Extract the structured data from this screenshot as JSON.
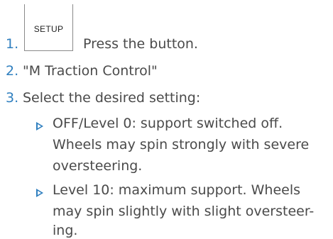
{
  "step1": {
    "number": "1.",
    "button_label": "SETUP",
    "text": "Press the button."
  },
  "step2": {
    "number": "2.",
    "text": "\"M Traction Control\""
  },
  "step3": {
    "number": "3.",
    "text": "Select the desired setting:",
    "options": [
      {
        "lines": [
          "OFF/Level 0: support switched off.",
          "Wheels may spin strongly with severe",
          "oversteering."
        ]
      },
      {
        "lines": [
          "Level 10: maximum support. Wheels",
          "may spin slightly with slight oversteer-",
          "ing."
        ]
      }
    ]
  },
  "colors": {
    "accent": "#2f7fbf",
    "text": "#4a4a4a"
  }
}
